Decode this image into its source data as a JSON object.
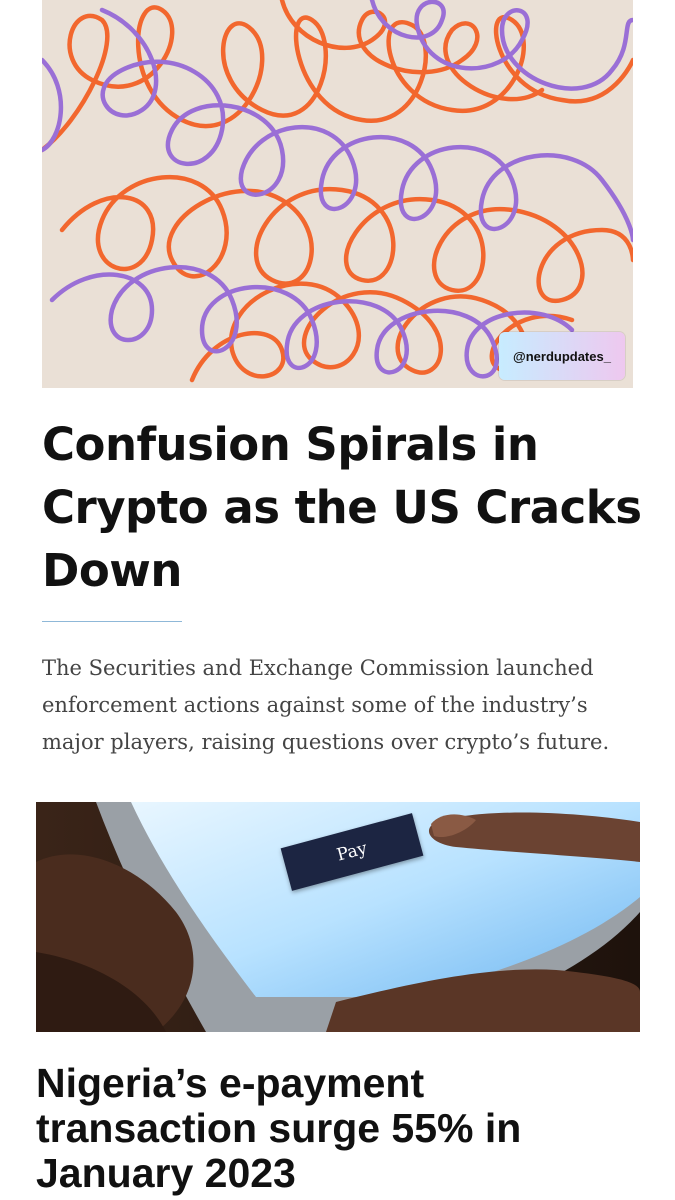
{
  "article1": {
    "watermark": "@nerdupdates_",
    "headline": "Confusion Spirals in Crypto as the US Cracks Down",
    "summary": "The Securities and Exchange Commission launched enforcement actions against some of the industry’s major players, raising questions over crypto’s future."
  },
  "article2": {
    "pay_button_label": "Pay",
    "headline": "Nigeria’s e-payment transaction surge 55% in January 2023"
  },
  "colors": {
    "hero_background": "#eae0d6",
    "orange_cord": "#f2672e",
    "purple_cord": "#9a6fd6",
    "rule": "#8fb8d8",
    "pay_button": "#1c2542"
  }
}
